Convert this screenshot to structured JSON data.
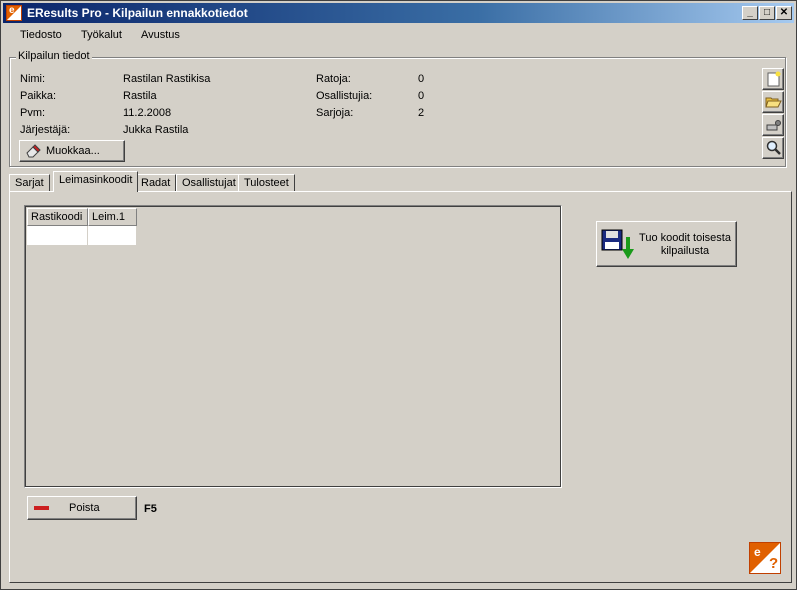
{
  "window": {
    "title": "EResults Pro - Kilpailun ennakkotiedot",
    "minimize": "_",
    "maximize": "□",
    "close": "✕"
  },
  "menu": {
    "items": [
      "Tiedosto",
      "Työkalut",
      "Avustus"
    ]
  },
  "competition": {
    "group_label": "Kilpailun tiedot",
    "fields": [
      {
        "label": "Nimi:",
        "value": "Rastilan Rastikisa"
      },
      {
        "label": "Paikka:",
        "value": "Rastila"
      },
      {
        "label": "Pvm:",
        "value": "11.2.2008"
      },
      {
        "label": "Järjestäjä:",
        "value": "Jukka Rastila"
      }
    ],
    "stats": [
      {
        "label": "Ratoja:",
        "value": "0"
      },
      {
        "label": "Osallistujia:",
        "value": "0"
      },
      {
        "label": "Sarjoja:",
        "value": "2"
      }
    ],
    "edit_button": "Muokkaa..."
  },
  "side_buttons": [
    "new-document-icon",
    "open-folder-icon",
    "settings-icon",
    "search-icon"
  ],
  "tabs": {
    "items": [
      "Sarjat",
      "Leimasinkoodit",
      "Radat",
      "Osallistujat",
      "Tulosteet"
    ],
    "active": "Leimasinkoodit"
  },
  "grid": {
    "columns": [
      "Rastikoodi",
      "Leim.1"
    ]
  },
  "import_button": {
    "label_line1": "Tuo koodit toisesta",
    "label_line2": "kilpailusta"
  },
  "delete_button": {
    "label": "Poista",
    "shortcut": "F5"
  },
  "help_button": {
    "label": "?"
  },
  "colors": {
    "titlebar_start": "#0a246a",
    "titlebar_end": "#a6caf0",
    "face": "#d4d0c8",
    "accent": "#e06000",
    "delete_red": "#cc2020",
    "import_green": "#1a9a1a"
  }
}
